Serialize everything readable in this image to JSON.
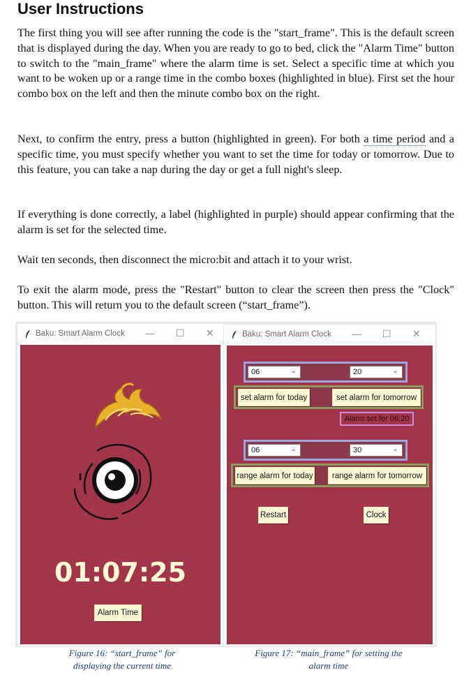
{
  "heading": "User Instructions",
  "paragraphs": {
    "p1": "The first thing you will see after running the code is the \"start_frame\". This is the default screen that is displayed during the day. When you are ready to go to bed, click the \"Alarm Time\" button to switch to the \"main_frame\" where the alarm time is set. Select a specific time at which you want to be woken up or a range time in the combo boxes (highlighted in blue). First set the hour combo box on the left and then the minute combo box on the right.",
    "p2_before": "Next, to confirm the entry, press a button (highlighted in green). For both ",
    "p2_dotted": "a time period",
    "p2_after": " and a specific time, you must specify whether you want to set the time for today or tomorrow. Due to this feature, you can take a nap during the day or get a full night's sleep.",
    "p3": "If everything is done correctly, a label (highlighted in purple) should appear confirming that the alarm is set for the selected time.",
    "p4": "Wait ten seconds, then disconnect the micro:bit and attach it to your wrist.",
    "p5": "To exit the alarm mode, press the \"Restart\" button to clear the screen then press the \"Clock\" button. This will return you to the default screen (“start_frame”)."
  },
  "window_left": {
    "title": "Baku: Smart Alarm Clock",
    "clock": "01:07:25",
    "alarm_button": "Alarm Time"
  },
  "window_right": {
    "title": "Baku: Smart Alarm Clock",
    "hour_combo_1": "06",
    "minute_combo_1": "20",
    "set_today": "set alarm for today",
    "set_tomorrow": "set alarm for tomorrow",
    "alarm_label": "Alarm set for 06:20",
    "hour_combo_2": "06",
    "minute_combo_2": "30",
    "range_today": "range alarm for today",
    "range_tomorrow": "range alarm for tomorrow",
    "restart": "Restart",
    "clock_button": "Clock"
  },
  "window_controls": {
    "minimize": "—",
    "maximize": "☐",
    "close": "✕"
  },
  "icons": {
    "feather": "feather-icon",
    "combo_arrow": "chevron-down-icon"
  },
  "colors": {
    "app_background": "#a23549",
    "button_background": "#fffbd6",
    "highlight_blue": "#9ea4e0",
    "highlight_green": "#8a9c5c",
    "highlight_purple": "#d28ae0"
  },
  "captions": {
    "figure16_line1": "Figure 16: “start_frame” for",
    "figure16_line2": "displaying the current time",
    "figure17_line1": "Figure 17: “main_frame” for setting the",
    "figure17_line2": "alarm time"
  }
}
